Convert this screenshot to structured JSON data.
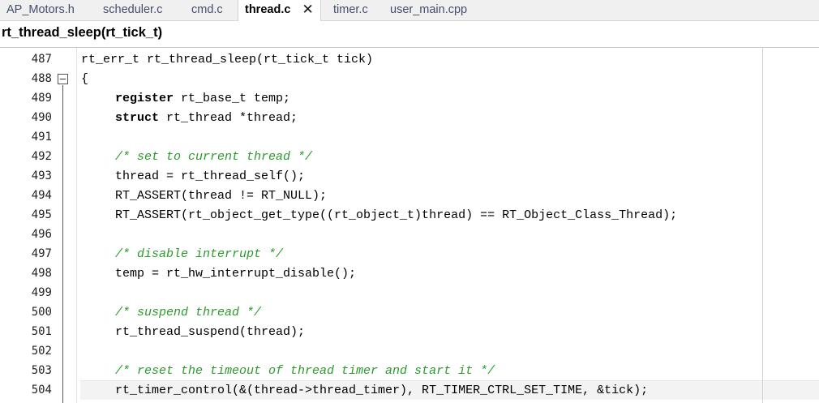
{
  "tabs": [
    {
      "label": "AP_Motors.h",
      "active": false
    },
    {
      "label": "scheduler.c",
      "active": false
    },
    {
      "label": "cmd.c",
      "active": false
    },
    {
      "label": "thread.c",
      "active": true
    },
    {
      "label": "timer.c",
      "active": false
    },
    {
      "label": "user_main.cpp",
      "active": false
    }
  ],
  "function_bar": {
    "title": "rt_thread_sleep(rt_tick_t)"
  },
  "editor": {
    "lines": [
      {
        "no": "487",
        "text": "rt_err_t rt_thread_sleep(rt_tick_t tick)"
      },
      {
        "no": "488",
        "text": "{"
      },
      {
        "no": "489",
        "kw": "register",
        "text": " rt_base_t temp;"
      },
      {
        "no": "490",
        "kw": "struct",
        "text": " rt_thread *thread;"
      },
      {
        "no": "491",
        "text": ""
      },
      {
        "no": "492",
        "comment": "/* set to current thread */"
      },
      {
        "no": "493",
        "text": "thread = rt_thread_self();"
      },
      {
        "no": "494",
        "text": "RT_ASSERT(thread != RT_NULL);"
      },
      {
        "no": "495",
        "text": "RT_ASSERT(rt_object_get_type((rt_object_t)thread) == RT_Object_Class_Thread);"
      },
      {
        "no": "496",
        "text": ""
      },
      {
        "no": "497",
        "comment": "/* disable interrupt */"
      },
      {
        "no": "498",
        "text": "temp = rt_hw_interrupt_disable();"
      },
      {
        "no": "499",
        "text": ""
      },
      {
        "no": "500",
        "comment": "/* suspend thread */"
      },
      {
        "no": "501",
        "text": "rt_thread_suspend(thread);"
      },
      {
        "no": "502",
        "text": ""
      },
      {
        "no": "503",
        "comment": "/* reset the timeout of thread timer and start it */"
      },
      {
        "no": "504",
        "text": "rt_timer_control(&(thread->thread_timer), RT_TIMER_CTRL_SET_TIME, &tick);"
      }
    ]
  },
  "colors": {
    "comment": "#2b9a2b",
    "keyword": "#000000",
    "tab_text": "#444e6b"
  }
}
